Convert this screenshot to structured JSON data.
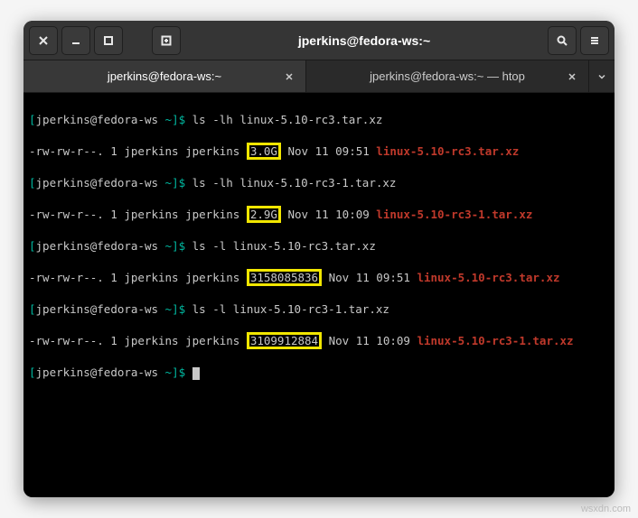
{
  "window": {
    "title": "jperkins@fedora-ws:~"
  },
  "tabs": [
    {
      "label": "jperkins@fedora-ws:~",
      "active": true
    },
    {
      "label": "jperkins@fedora-ws:~ — htop",
      "active": false
    }
  ],
  "prompt": {
    "user_host": "jperkins@fedora-ws",
    "path": "~",
    "sep_open": "[",
    "sep_close": "]$"
  },
  "lines": [
    {
      "cmd": "ls -lh linux-5.10-rc3.tar.xz"
    },
    {
      "perms": "-rw-rw-r--. 1 jperkins jperkins ",
      "size": "3.0G",
      "date": " Nov 11 09:51 ",
      "file": "linux-5.10-rc3.tar.xz"
    },
    {
      "cmd": "ls -lh linux-5.10-rc3-1.tar.xz"
    },
    {
      "perms": "-rw-rw-r--. 1 jperkins jperkins ",
      "size": "2.9G",
      "date": " Nov 11 10:09 ",
      "file": "linux-5.10-rc3-1.tar.xz"
    },
    {
      "cmd": "ls -l linux-5.10-rc3.tar.xz"
    },
    {
      "perms": "-rw-rw-r--. 1 jperkins jperkins ",
      "size": "3158085836",
      "date": " Nov 11 09:51 ",
      "file": "linux-5.10-rc3.tar.xz"
    },
    {
      "cmd": "ls -l linux-5.10-rc3-1.tar.xz"
    },
    {
      "perms": "-rw-rw-r--. 1 jperkins jperkins ",
      "size": "3109912884",
      "date": " Nov 11 10:09 ",
      "file": "linux-5.10-rc3-1.tar.xz"
    }
  ],
  "watermark": "wsxdn.com"
}
